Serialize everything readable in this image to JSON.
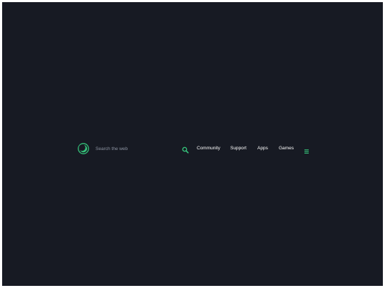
{
  "search": {
    "placeholder": "Search the web",
    "value": ""
  },
  "nav": {
    "links": [
      {
        "label": "Community"
      },
      {
        "label": "Support"
      },
      {
        "label": "Apps"
      },
      {
        "label": "Games"
      }
    ]
  },
  "icons": {
    "logo": "crescent-moon-logo-icon",
    "search": "magnifier-icon",
    "menu": "hamburger-menu-icon"
  },
  "colors": {
    "background": "#171a23",
    "accent": "#35c27a",
    "link": "#ffffff",
    "placeholder": "#8d94a2"
  }
}
